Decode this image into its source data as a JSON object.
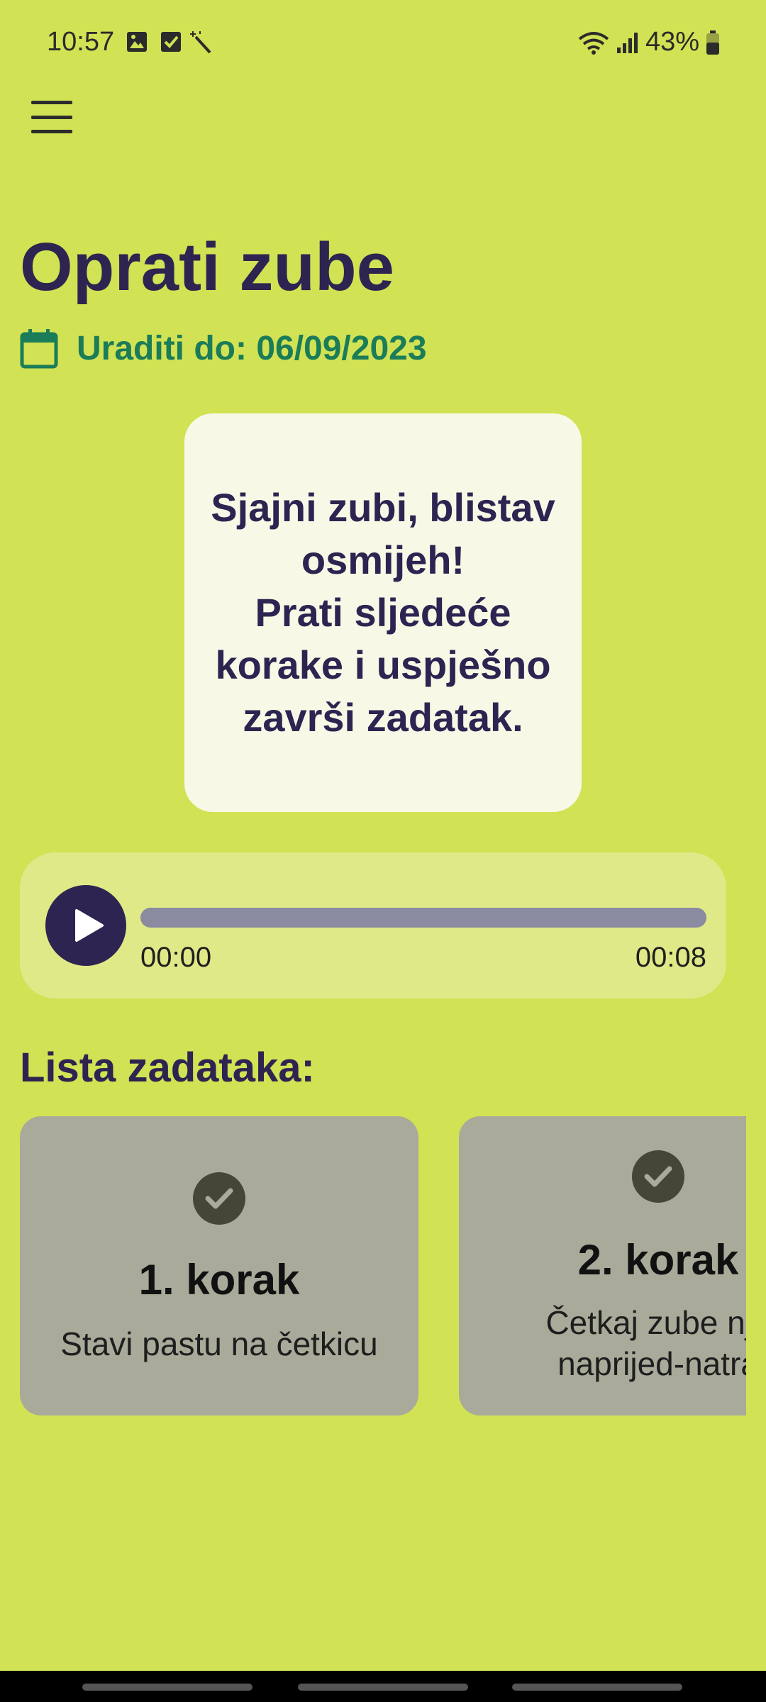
{
  "status_bar": {
    "time": "10:57",
    "battery": "43%",
    "icons": [
      "image-icon",
      "checkbox-icon",
      "magic-wand-icon",
      "wifi-icon",
      "signal-icon",
      "battery-icon"
    ]
  },
  "header": {
    "menu_icon": "hamburger-menu-icon"
  },
  "task": {
    "title": "Oprati zube",
    "due_label": "Uraditi do: 06/09/2023",
    "intro": "Sjajni zubi, blistav\nosmijeh!\nPrati sljedeće\nkorake i uspješno\nzavrši zadatak."
  },
  "player": {
    "current_time": "00:00",
    "duration": "00:08",
    "progress": 0
  },
  "steps_section": {
    "heading": "Lista zadataka:",
    "steps": [
      {
        "title": "1. korak",
        "description": "Stavi pastu na četkicu"
      },
      {
        "title": "2. korak",
        "description": "Četkaj zube nje\nnaprijed-natra"
      }
    ]
  },
  "colors": {
    "background": "#d1e254",
    "primary": "#2d2451",
    "due_green": "#1a7c58",
    "card": "#f7f9e6",
    "step_card": "#a9aa9a"
  }
}
